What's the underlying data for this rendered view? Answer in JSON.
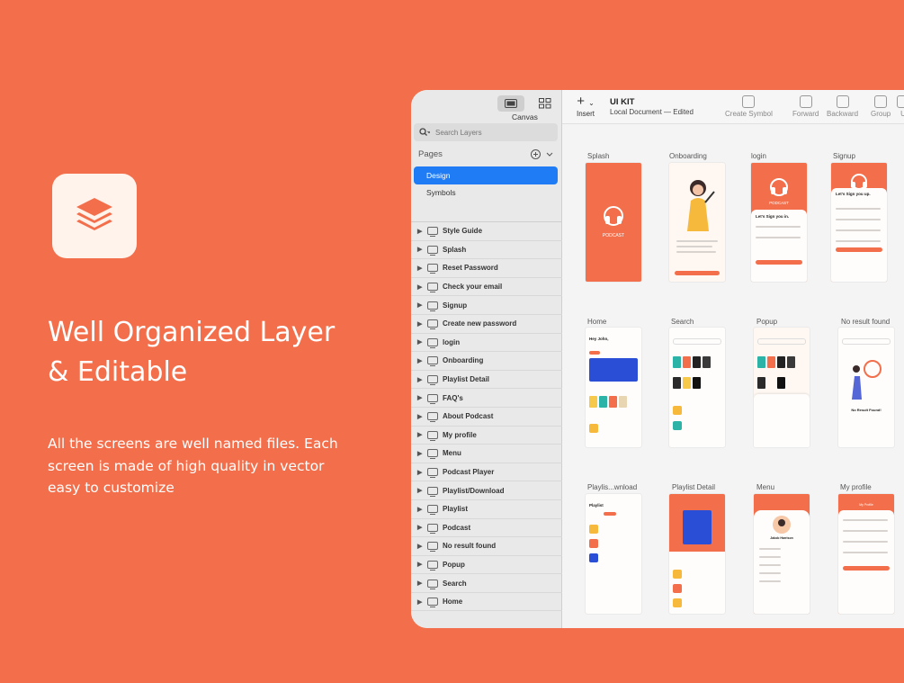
{
  "hero": {
    "headline_line1": "Well Organized Layer",
    "headline_line2": "& Editable",
    "subtext_line1": "All the screens are well named files. Each",
    "subtext_line2": "screen is made of high quality in vector",
    "subtext_line3": "easy to customize"
  },
  "sidebar": {
    "canvas_label": "Canvas",
    "search_placeholder": "Search Layers",
    "pages_label": "Pages",
    "pages": [
      "Design",
      "Symbols"
    ],
    "layers": [
      "Style Guide",
      "Splash",
      "Reset Password",
      "Check your email",
      "Signup",
      "Create new password",
      "login",
      "Onboarding",
      "Playlist Detail",
      "FAQ's",
      "About Podcast",
      "My profile",
      "Menu",
      "Podcast Player",
      "Playlist/Download",
      "Playlist",
      "Podcast",
      "No result found",
      "Popup",
      "Search",
      "Home"
    ]
  },
  "toolbar": {
    "insert_label": "Insert",
    "doc_title": "UI KIT",
    "doc_status": "Local Document — Edited",
    "buttons": [
      "Create Symbol",
      "Forward",
      "Backward",
      "Group",
      "U"
    ]
  },
  "artboards": {
    "splash": "Splash",
    "onboarding": "Onboarding",
    "login": "login",
    "signup": "Signup",
    "home": "Home",
    "search": "Search",
    "popup": "Popup",
    "no_result": "No result found",
    "playlist_download": "Playlis...wnload",
    "playlist_detail": "Playlist Detail",
    "menu": "Menu",
    "my_profile": "My profile"
  },
  "screen_text": {
    "podcast": "PODCAST",
    "lets_sign_in": "Let's Sign you in.",
    "lets_sign_up": "Let's Sign you up.",
    "hey_john": "Hey John,",
    "playlist": "Playlist",
    "no_result_found": "No Result Found!",
    "user_name": "Jakob Harrison",
    "my_profile": "My Profile"
  },
  "colors": {
    "background": "#f36f4c",
    "selection": "#1f7cf5",
    "sidebar": "#e9e9e9",
    "canvas": "#f4f4f4"
  }
}
